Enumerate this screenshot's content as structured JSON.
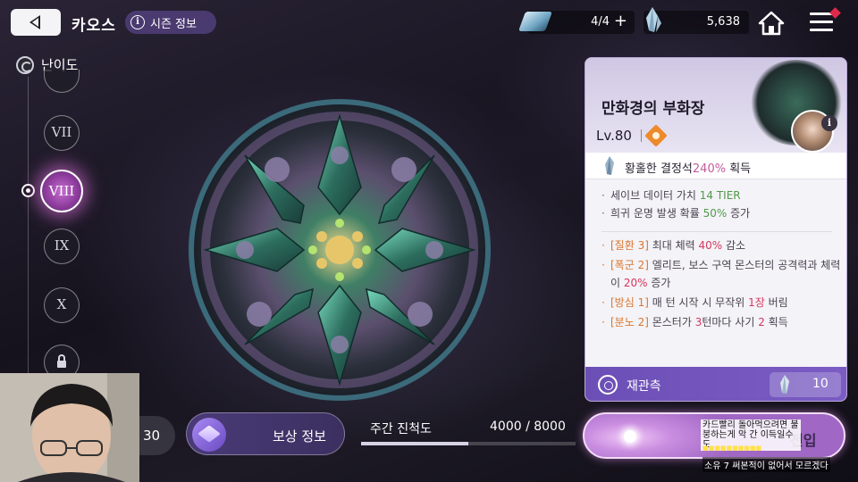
{
  "header": {
    "title": "카오스",
    "season_info_label": "시즌 정보",
    "info_glyph": "i",
    "stamina": "4/4",
    "stamina_plus": "+",
    "crystals": "5,638",
    "icons": [
      "back-arrow-icon",
      "info-icon",
      "stamina-ticket-icon",
      "plus-icon",
      "crystal-icon",
      "home-icon",
      "menu-icon",
      "notification-dot-icon"
    ]
  },
  "difficulty": {
    "label": "난이도",
    "levels": [
      "VII",
      "VIII",
      "IX",
      "X"
    ],
    "selected": "VIII",
    "locked_level_icon": "lock-icon"
  },
  "boss": {
    "name": "만화경의 부화장",
    "level": "Lv.80",
    "element_icon": "orange-diamond-element-icon",
    "info_glyph": "i",
    "drop": {
      "prefix": "황홀한 결정석",
      "highlight": "240%",
      "suffix": " 획득"
    },
    "effects": [
      {
        "prefix": "세이브 데이터 가치 ",
        "highlight": "14 TIER",
        "suffix": ""
      },
      {
        "prefix": "희귀 운명 발생 확률 ",
        "highlight": "50%",
        "suffix": " 증가"
      }
    ],
    "modifiers": [
      {
        "tag": "[질환 3]",
        "prefix": " 최대 체력 ",
        "highlight": "40%",
        "suffix": " 감소"
      },
      {
        "tag": "[폭군 2]",
        "prefix": " 엘리트, 보스 구역 몬스터의 공격력과 체력이 ",
        "highlight": "20%",
        "suffix": " 증가"
      },
      {
        "tag": "[방심 1]",
        "prefix": " 매 턴 시작 시 무작위 ",
        "highlight": "1장",
        "suffix": " 버림"
      },
      {
        "tag": "[분노 2]",
        "prefix": " 몬스터가 ",
        "highlight": "3",
        "suffix": "턴마다 사기 ",
        "highlight2": "2",
        "suffix2": " 획득"
      }
    ],
    "reobserve": {
      "label": "재관측",
      "count": "10"
    }
  },
  "bottom": {
    "left_value": "30",
    "reward_label": "보상 정보",
    "weekly_progress_label": "주간 진척도",
    "weekly_progress_value": "4000 / 8000",
    "weekly_progress_fraction": 0.5,
    "start_label": "전입"
  },
  "chat": {
    "line1": "카드빨리 돌아먹으려면 불붕하는게 악 간 이득일수도",
    "line2": "■■■■■■■■■■",
    "line3": "소유 7 써본적이 없어서 모르겠다"
  },
  "colors": {
    "panel_accent": "#7b5cc4",
    "difficulty_active": "#c46fd0",
    "drop_highlight": "#c25b9a",
    "effect_highlight": "#4f9a4a",
    "modifier_tag": "#d9752e",
    "modifier_value": "#d6365e"
  }
}
